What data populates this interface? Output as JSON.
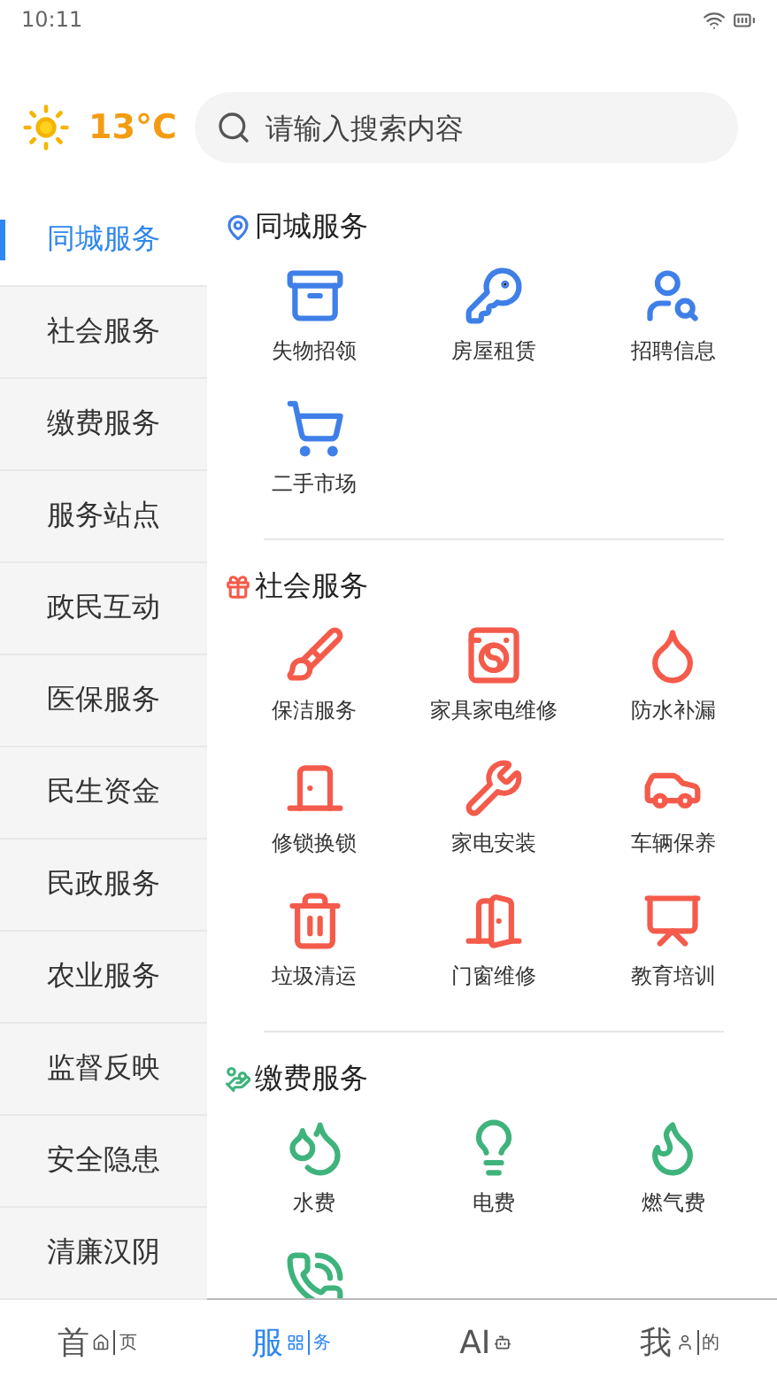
{
  "status_bar": {
    "time": "10:11"
  },
  "header": {
    "temperature": "13°C",
    "search": {
      "placeholder": "请输入搜索内容"
    }
  },
  "sidebar": {
    "items": [
      {
        "label": "同城服务",
        "selected": true
      },
      {
        "label": "社会服务",
        "selected": false
      },
      {
        "label": "缴费服务",
        "selected": false
      },
      {
        "label": "服务站点",
        "selected": false
      },
      {
        "label": "政民互动",
        "selected": false
      },
      {
        "label": "医保服务",
        "selected": false
      },
      {
        "label": "民生资金",
        "selected": false
      },
      {
        "label": "民政服务",
        "selected": false
      },
      {
        "label": "农业服务",
        "selected": false
      },
      {
        "label": "监督反映",
        "selected": false
      },
      {
        "label": "安全隐患",
        "selected": false
      },
      {
        "label": "清廉汉阴",
        "selected": false
      }
    ]
  },
  "sections": [
    {
      "title": "同城服务",
      "color": "#3f7fe8",
      "items": [
        {
          "kind": "service",
          "label": "失物招领"
        },
        {
          "kind": "service",
          "label": "房屋租赁"
        },
        {
          "kind": "service",
          "label": "招聘信息"
        },
        {
          "kind": "service",
          "label": "二手市场"
        }
      ]
    },
    {
      "title": "社会服务",
      "color": "#f45b4b",
      "items": [
        {
          "kind": "service",
          "label": "保洁服务"
        },
        {
          "kind": "service",
          "label": "家具家电维修"
        },
        {
          "kind": "service",
          "label": "防水补漏"
        },
        {
          "kind": "service",
          "label": "修锁换锁"
        },
        {
          "kind": "service",
          "label": "家电安装"
        },
        {
          "kind": "service",
          "label": "车辆保养"
        },
        {
          "kind": "service",
          "label": "垃圾清运"
        },
        {
          "kind": "service",
          "label": "门窗维修"
        },
        {
          "kind": "service",
          "label": "教育培训"
        }
      ]
    },
    {
      "title": "缴费服务",
      "color": "#3fb37c",
      "items": [
        {
          "kind": "service",
          "label": "水费"
        },
        {
          "kind": "service",
          "label": "电费"
        },
        {
          "kind": "service",
          "label": "燃气费"
        },
        {
          "kind": "icon"
        }
      ]
    }
  ],
  "tab_bar": {
    "tabs": [
      {
        "label": "首",
        "sub": "页",
        "selected": false
      },
      {
        "label": "服",
        "sub": "务",
        "selected": true
      },
      {
        "label": "AI",
        "selected": false
      },
      {
        "label": "我",
        "sub": "的",
        "selected": false
      }
    ]
  }
}
